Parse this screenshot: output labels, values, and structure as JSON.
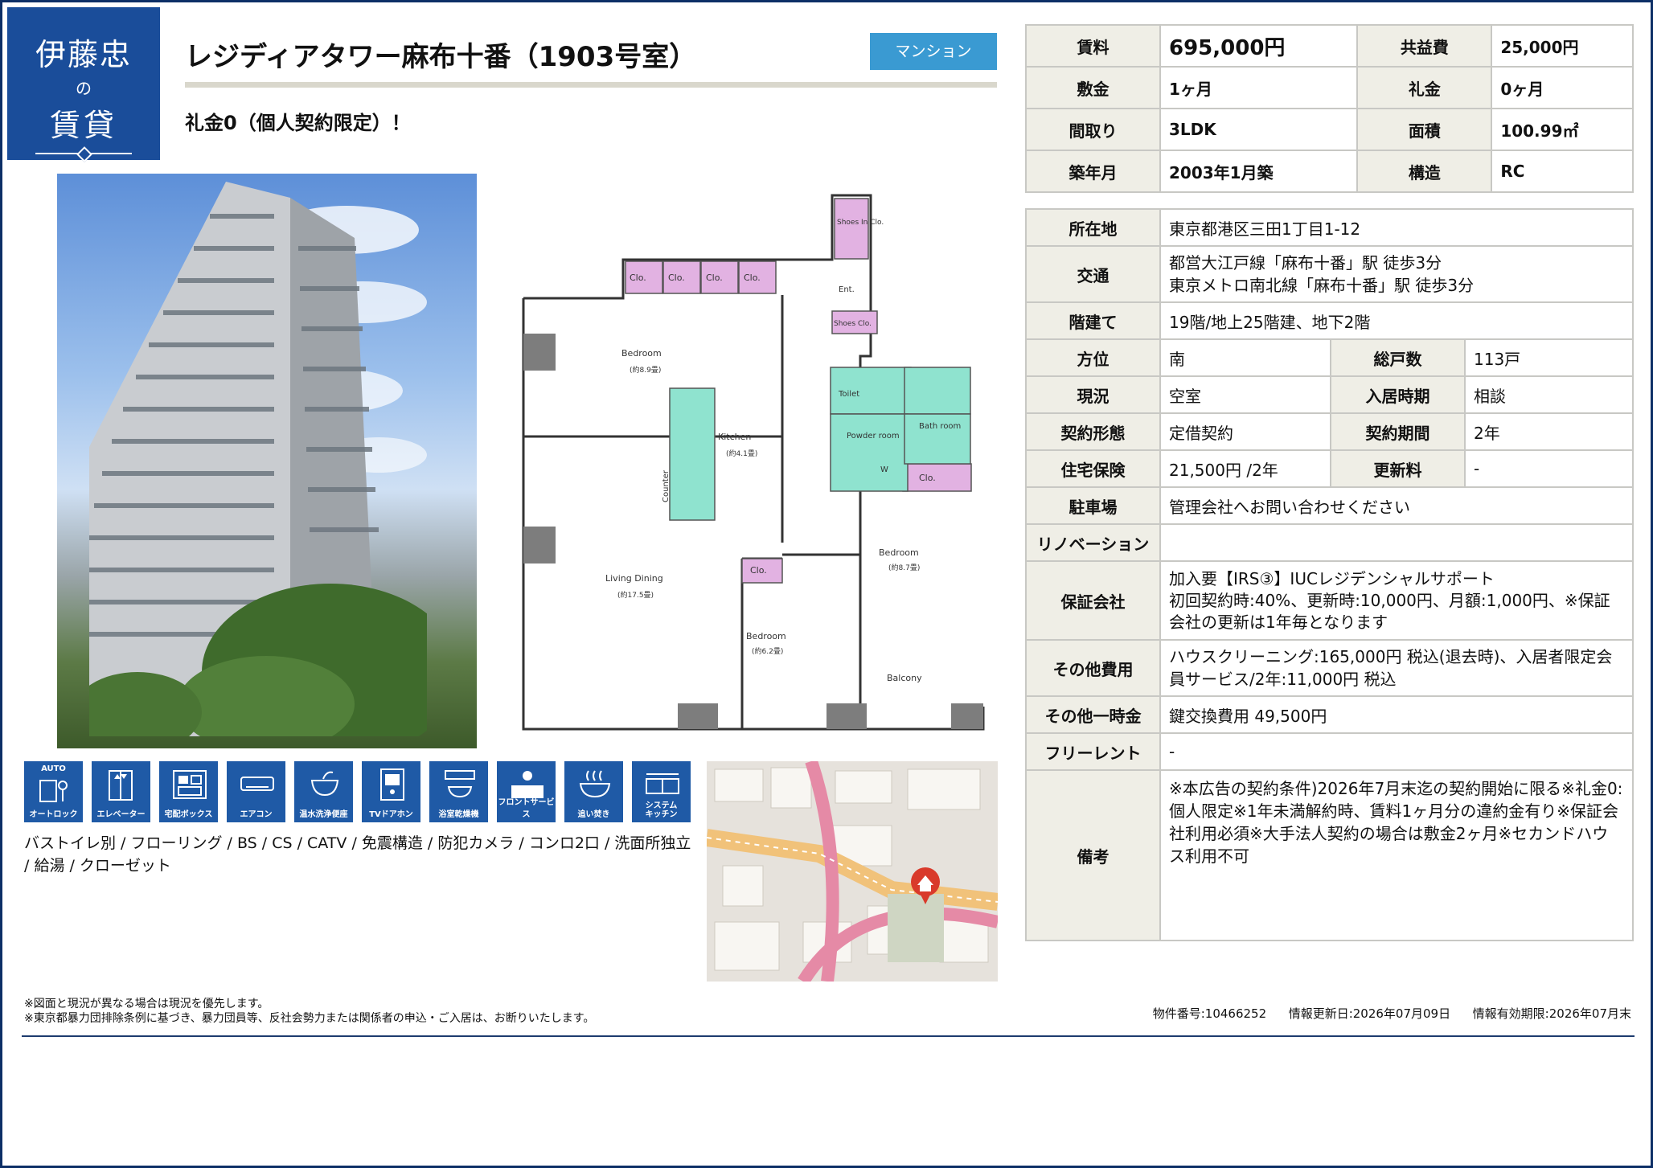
{
  "logo": {
    "line1": "伊藤忠",
    "line2": "の",
    "line3": "賃貸"
  },
  "title": "レジディアタワー麻布十番（1903号室）",
  "property_type": "マンション",
  "catch_copy": "礼金0（個人契約限定）！",
  "floorplan": {
    "rooms": {
      "bedroom1": "Bedroom",
      "bedroom1_size": "(約8.9畳)",
      "kitchen": "Kitchen",
      "kitchen_size": "(約4.1畳)",
      "counter": "Counter",
      "living": "Living Dining",
      "living_size": "(約17.5畳)",
      "bedroom2": "Bedroom",
      "bedroom2_size": "(約6.2畳)",
      "bedroom3": "Bedroom",
      "bedroom3_size": "(約8.7畳)",
      "balcony": "Balcony",
      "powder": "Powder room",
      "bath": "Bath room",
      "toilet": "Toilet",
      "entrance": "Ent.",
      "shoes_in": "Shoes In Clo.",
      "shoes": "Shoes Clo.",
      "clo": "Clo.",
      "washer": "W"
    }
  },
  "amenity_icons": [
    {
      "name": "auto-lock-icon",
      "label": "オートロック",
      "badge": "AUTO"
    },
    {
      "name": "elevator-icon",
      "label": "エレベーター"
    },
    {
      "name": "delivery-box-icon",
      "label": "宅配ボックス"
    },
    {
      "name": "air-conditioner-icon",
      "label": "エアコン"
    },
    {
      "name": "washlet-icon",
      "label": "温水洗浄便座"
    },
    {
      "name": "tv-intercom-icon",
      "label": "TVドアホン"
    },
    {
      "name": "bathroom-dryer-icon",
      "label": "浴室乾燥機"
    },
    {
      "name": "front-service-icon",
      "label": "フロントサービス"
    },
    {
      "name": "reheating-bath-icon",
      "label": "追い焚き"
    },
    {
      "name": "system-kitchen-icon",
      "label": "システム\nキッチン"
    }
  ],
  "features_text": "バストイレ別 / フローリング / BS / CS / CATV / 免震構造 / 防犯カメラ / コンロ2口 / 洗面所独立 / 給湯 / クローゼット",
  "summary": {
    "rent_label": "賃料",
    "rent": "695,000円",
    "common_fee_label": "共益費",
    "common_fee": "25,000円",
    "deposit_label": "敷金",
    "deposit": "1ヶ月",
    "key_money_label": "礼金",
    "key_money": "0ヶ月",
    "layout_label": "間取り",
    "layout": "3LDK",
    "area_label": "面積",
    "area": "100.99㎡",
    "built_label": "築年月",
    "built": "2003年1月築",
    "structure_label": "構造",
    "structure": "RC"
  },
  "details": {
    "address_label": "所在地",
    "address": "東京都港区三田1丁目1-12",
    "transport_label": "交通",
    "transport1": "都営大江戸線「麻布十番」駅 徒歩3分",
    "transport2": "東京メトロ南北線「麻布十番」駅 徒歩3分",
    "floor_label": "階建て",
    "floor": "19階/地上25階建、地下2階",
    "direction_label": "方位",
    "direction": "南",
    "units_label": "総戸数",
    "units": "113戸",
    "status_label": "現況",
    "status": "空室",
    "move_in_label": "入居時期",
    "move_in": "相談",
    "contract_label": "契約形態",
    "contract": "定借契約",
    "period_label": "契約期間",
    "period": "2年",
    "insurance_label": "住宅保険",
    "insurance": "21,500円 /2年",
    "renewal_label": "更新料",
    "renewal": "-",
    "parking_label": "駐車場",
    "parking": "管理会社へお問い合わせください",
    "renovation_label": "リノベーション",
    "renovation": "",
    "guarantor_label": "保証会社",
    "guarantor1": "加入要【IRS③】IUCレジデンシャルサポート",
    "guarantor2": "初回契約時:40%、更新時:10,000円、月額:1,000円、※保証会社の更新は1年毎となります",
    "other_fees_label": "その他費用",
    "other_fees": "ハウスクリーニング:165,000円 税込(退去時)、入居者限定会員サービス/2年:11,000円 税込",
    "other_once_label": "その他一時金",
    "other_once": "鍵交換費用 49,500円",
    "free_rent_label": "フリーレント",
    "free_rent": "-",
    "remarks_label": "備考",
    "remarks": "※本広告の契約条件)2026年7月末迄の契約開始に限る※礼金0:個人限定※1年未満解約時、賃料1ヶ月分の違約金有り※保証会社利用必須※大手法人契約の場合は敷金2ヶ月※セカンドハウス利用不可"
  },
  "notes": {
    "line1": "※図面と現況が異なる場合は現況を優先します。",
    "line2": "※東京都暴力団排除条例に基づき、暴力団員等、反社会勢力または関係者の申込・ご入居は、お断りいたします。"
  },
  "meta": {
    "property_no": "物件番号:10466252",
    "updated": "情報更新日:2026年07月09日",
    "valid_until": "情報有効期限:2026年07月末"
  }
}
